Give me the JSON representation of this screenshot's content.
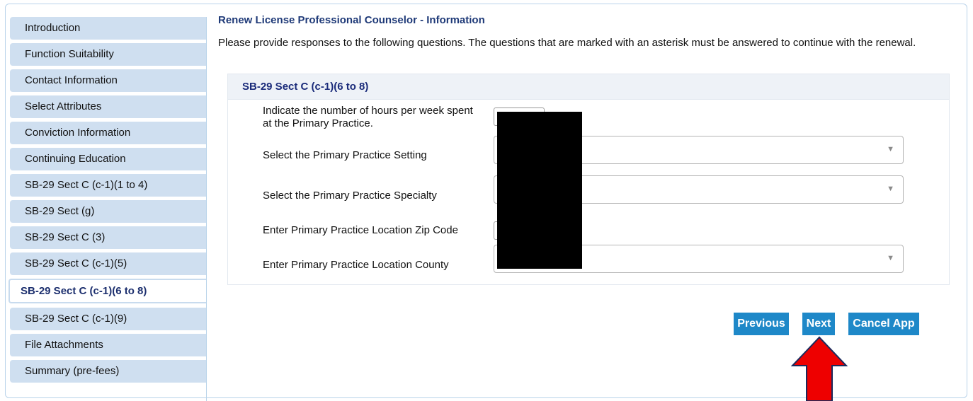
{
  "sidebar": {
    "items": [
      {
        "label": "Introduction"
      },
      {
        "label": "Function Suitability"
      },
      {
        "label": "Contact Information"
      },
      {
        "label": "Select Attributes"
      },
      {
        "label": "Conviction Information"
      },
      {
        "label": "Continuing Education"
      },
      {
        "label": "SB-29 Sect C (c-1)(1 to 4)"
      },
      {
        "label": "SB-29 Sect (g)"
      },
      {
        "label": "SB-29 Sect C (3)"
      },
      {
        "label": "SB-29 Sect C (c-1)(5)"
      },
      {
        "label": "SB-29 Sect C (c-1)(6 to 8)",
        "active": true
      },
      {
        "label": "SB-29 Sect C (c-1)(9)"
      },
      {
        "label": "File Attachments"
      },
      {
        "label": "Summary (pre-fees)"
      }
    ]
  },
  "page": {
    "title": "Renew License Professional Counselor - Information",
    "instructions": "Please provide responses to the following questions. The questions that are marked with an asterisk must be answered to continue with the renewal."
  },
  "section": {
    "header": "SB-29 Sect C (c-1)(6 to 8)",
    "questions": {
      "hours": {
        "label": "Indicate the number of hours per week spent at the Primary Practice.",
        "value": ""
      },
      "setting": {
        "label": "Select the Primary Practice Setting",
        "value": ""
      },
      "specialty": {
        "label": "Select the Primary Practice Specialty",
        "value": ""
      },
      "zip": {
        "label": "Enter Primary Practice Location Zip Code",
        "value": ""
      },
      "county": {
        "label": "Enter Primary Practice Location County",
        "value": ""
      }
    }
  },
  "buttons": {
    "previous": "Previous",
    "next": "Next",
    "cancel": "Cancel App"
  },
  "colors": {
    "nav_bg": "#cfdff0",
    "button_bg": "#1e88c8",
    "arrow_fill": "#ee0000",
    "arrow_stroke": "#1b2a5c",
    "title_color": "#1f3a78"
  },
  "icons": {
    "dropdown": "chevron-down-icon",
    "arrow": "red-up-arrow-icon"
  }
}
